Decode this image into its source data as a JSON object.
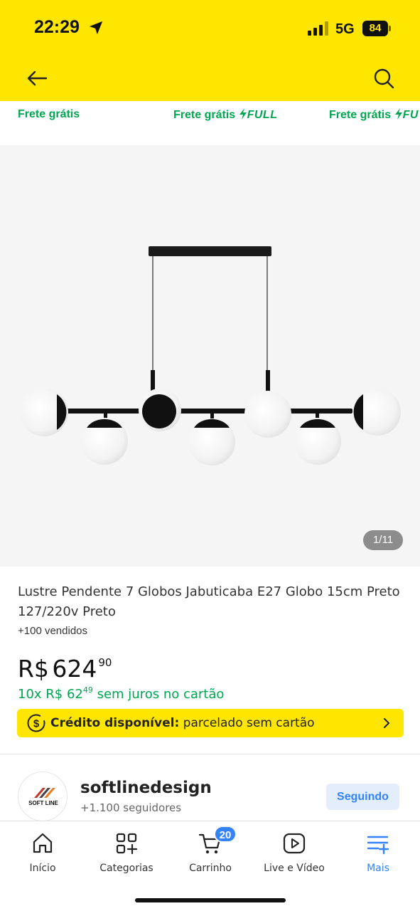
{
  "status_bar": {
    "time": "22:29",
    "network": "5G",
    "battery": "84"
  },
  "header": {
    "back_icon": "arrow-left-icon",
    "search_icon": "search-icon",
    "background": "#FFE600"
  },
  "shipping_badges": [
    {
      "label": "Frete grátis",
      "full": ""
    },
    {
      "label": "Frete grátis",
      "full": "FULL"
    },
    {
      "label": "Frete grátis",
      "full": "FU"
    }
  ],
  "gallery": {
    "counter": "1/11"
  },
  "product": {
    "title": "Lustre Pendente 7 Globos Jabuticaba E27 Globo 15cm Preto 127/220v Preto",
    "sold": "+100 vendidos",
    "currency": "R$",
    "price_main": "624",
    "price_cents": "90",
    "installments_prefix": "10x R$ 62",
    "installments_cents": "49",
    "installments_suffix": " sem juros no cartão"
  },
  "credit_banner": {
    "bold": "Crédito disponível:",
    "text": " parcelado sem cartão"
  },
  "seller": {
    "logo_text": "SOFT LINE",
    "name": "softlinedesign",
    "followers": "+1.100 seguidores",
    "follow_label": "Seguindo"
  },
  "tab_bar": {
    "items": [
      {
        "label": "Início",
        "icon": "home-icon"
      },
      {
        "label": "Categorias",
        "icon": "categories-icon"
      },
      {
        "label": "Carrinho",
        "icon": "cart-icon",
        "badge": "20"
      },
      {
        "label": "Live e Vídeo",
        "icon": "play-icon"
      },
      {
        "label": "Mais",
        "icon": "more-list-icon",
        "active": true
      }
    ]
  },
  "colors": {
    "brand_yellow": "#FFE600",
    "accent_blue": "#3483FA",
    "green": "#00A650"
  }
}
